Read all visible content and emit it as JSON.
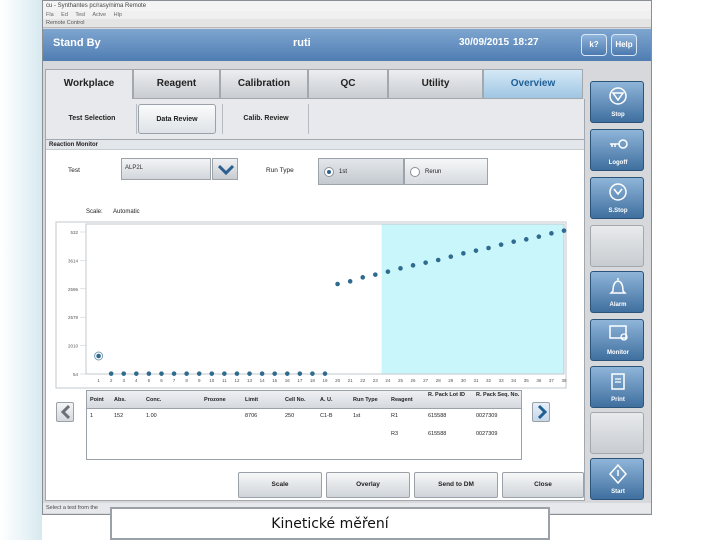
{
  "window": {
    "title": "cu - Synthantes pc/rasy/nima Remote",
    "menu": [
      "Fla",
      "Ed",
      "Tesl",
      "Actve",
      "Hlp"
    ],
    "subtitle": "Remote Control"
  },
  "header": {
    "status": "Stand By",
    "user": "ruti",
    "date": "30/09/2015",
    "time": "18:27",
    "help_q_label": "k?",
    "help_label": "Help"
  },
  "tabs": [
    {
      "label": "Workplace"
    },
    {
      "label": "Reagent"
    },
    {
      "label": "Calibration"
    },
    {
      "label": "QC"
    },
    {
      "label": "Utility"
    },
    {
      "label": "Overview"
    }
  ],
  "subtabs": [
    {
      "label": "Test Selection"
    },
    {
      "label": "Data Review"
    },
    {
      "label": "Calib. Review"
    }
  ],
  "section_title": "Reaction Monitor",
  "test": {
    "label": "Test",
    "value": "ALP2L"
  },
  "run_type": {
    "label": "Run Type",
    "options": [
      {
        "label": "1st",
        "selected": true
      },
      {
        "label": "Rerun",
        "selected": false
      }
    ]
  },
  "scale": {
    "label": "Scale:",
    "value": "Automatic"
  },
  "chart_data": {
    "type": "scatter",
    "y_tick_labels": [
      "532",
      "3614",
      "2596",
      "2578",
      "2010",
      "54"
    ],
    "x_ticks": [
      "1",
      "2",
      "3",
      "4",
      "5",
      "6",
      "7",
      "8",
      "9",
      "10",
      "11",
      "12",
      "13",
      "14",
      "15",
      "16",
      "17",
      "18",
      "19",
      "20",
      "21",
      "22",
      "23",
      "24",
      "25",
      "26",
      "27",
      "28",
      "29",
      "30",
      "31",
      "32",
      "33",
      "34",
      "35",
      "36",
      "37",
      "38"
    ],
    "points": [
      {
        "x": 1,
        "y": 54
      },
      {
        "x": 2,
        "y": 1
      },
      {
        "x": 3,
        "y": 1
      },
      {
        "x": 4,
        "y": 1
      },
      {
        "x": 5,
        "y": 1
      },
      {
        "x": 6,
        "y": 1
      },
      {
        "x": 7,
        "y": 1
      },
      {
        "x": 8,
        "y": 1
      },
      {
        "x": 9,
        "y": 1
      },
      {
        "x": 10,
        "y": 1
      },
      {
        "x": 11,
        "y": 1
      },
      {
        "x": 12,
        "y": 1
      },
      {
        "x": 13,
        "y": 1
      },
      {
        "x": 14,
        "y": 1
      },
      {
        "x": 15,
        "y": 1
      },
      {
        "x": 16,
        "y": 1
      },
      {
        "x": 17,
        "y": 1
      },
      {
        "x": 18,
        "y": 1
      },
      {
        "x": 19,
        "y": 1
      },
      {
        "x": 20,
        "y": 270
      },
      {
        "x": 21,
        "y": 278
      },
      {
        "x": 22,
        "y": 290
      },
      {
        "x": 23,
        "y": 298
      },
      {
        "x": 24,
        "y": 307
      },
      {
        "x": 25,
        "y": 317
      },
      {
        "x": 26,
        "y": 326
      },
      {
        "x": 27,
        "y": 334
      },
      {
        "x": 28,
        "y": 342
      },
      {
        "x": 29,
        "y": 352
      },
      {
        "x": 30,
        "y": 362
      },
      {
        "x": 31,
        "y": 370
      },
      {
        "x": 32,
        "y": 378
      },
      {
        "x": 33,
        "y": 388
      },
      {
        "x": 34,
        "y": 397
      },
      {
        "x": 35,
        "y": 404
      },
      {
        "x": 36,
        "y": 412
      },
      {
        "x": 37,
        "y": 422
      },
      {
        "x": 38,
        "y": 430
      }
    ],
    "highlight_from_x": 24,
    "highlight_to_x": 38,
    "xlim": [
      0,
      38
    ],
    "ylim": [
      0,
      450
    ],
    "marker_color": "#2f6b8e",
    "highlight_color": "#c8f6fb"
  },
  "table": {
    "headers": [
      "Point",
      "Abs.",
      "Conc.",
      "Prozone",
      "Limit",
      "Cell No.",
      "A. U.",
      "Run Type",
      "Reagent",
      "R. Pack Lot ID",
      "R. Pack Seq. No."
    ],
    "rows": [
      [
        "1",
        "152",
        "1.00",
        "",
        "8706",
        "250",
        "C1-B",
        "1st",
        "R1",
        "615588",
        "0027309"
      ],
      [
        "",
        "",
        "",
        "",
        "",
        "",
        "",
        "",
        "R3",
        "615588",
        "0027309"
      ]
    ]
  },
  "bottom_buttons": [
    {
      "label": "Scale"
    },
    {
      "label": "Overlay"
    },
    {
      "label": "Send to DM"
    },
    {
      "label": "Close"
    }
  ],
  "status_bar": "Select a test from the",
  "sidebar": [
    {
      "label": "Stop",
      "icon": "stop-icon",
      "enabled": true
    },
    {
      "label": "Logoff",
      "icon": "key-icon",
      "enabled": true
    },
    {
      "label": "S.Stop",
      "icon": "sampling-stop-icon",
      "enabled": true
    },
    {
      "label": "",
      "icon": "",
      "enabled": false
    },
    {
      "label": "Alarm",
      "icon": "bell-icon",
      "enabled": true
    },
    {
      "label": "Monitor",
      "icon": "monitor-icon",
      "enabled": true
    },
    {
      "label": "Print",
      "icon": "printer-icon",
      "enabled": true
    },
    {
      "label": "",
      "icon": "",
      "enabled": false
    },
    {
      "label": "Start",
      "icon": "start-icon",
      "enabled": true
    }
  ],
  "caption": "Kinetické měření",
  "colors": {
    "header_blue": "#4f7db3",
    "overview_tab": "#1e5f95",
    "highlight_cyan": "#c8f6fb"
  }
}
